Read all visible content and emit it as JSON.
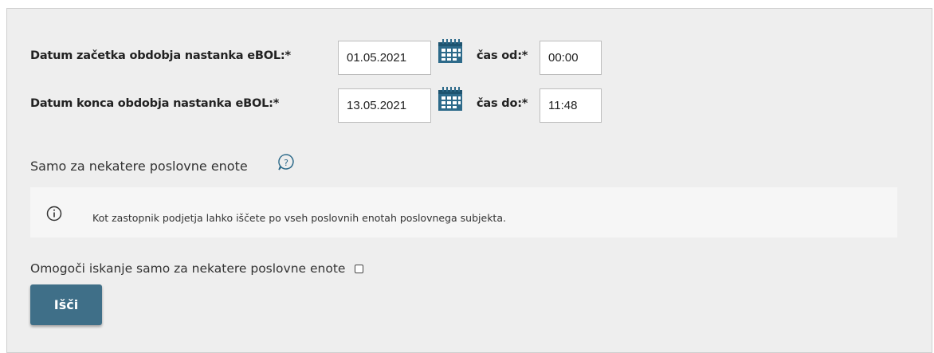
{
  "form": {
    "start_label": "Datum začetka obdobja nastanka eBOL:*",
    "start_date": "01.05.2021",
    "time_from_label": "čas od:*",
    "time_from": "00:00",
    "end_label": "Datum konca obdobja nastanka eBOL:*",
    "end_date": "13.05.2021",
    "time_to_label": "čas do:*",
    "time_to": "11:48"
  },
  "units": {
    "section_label": "Samo za nekatere poslovne enote",
    "info_text": "Kot zastopnik podjetja lahko iščete po vseh poslovnih enotah poslovnega subjekta.",
    "checkbox_label": "Omogoči iskanje samo za nekatere poslovne enote",
    "checkbox_checked": false
  },
  "actions": {
    "search_label": "Išči"
  },
  "colors": {
    "accent": "#3f6f88",
    "calendar_icon": "#2d6a8a",
    "panel_bg": "#eeeeee"
  },
  "icons": [
    "calendar-icon",
    "help-icon",
    "info-icon"
  ]
}
